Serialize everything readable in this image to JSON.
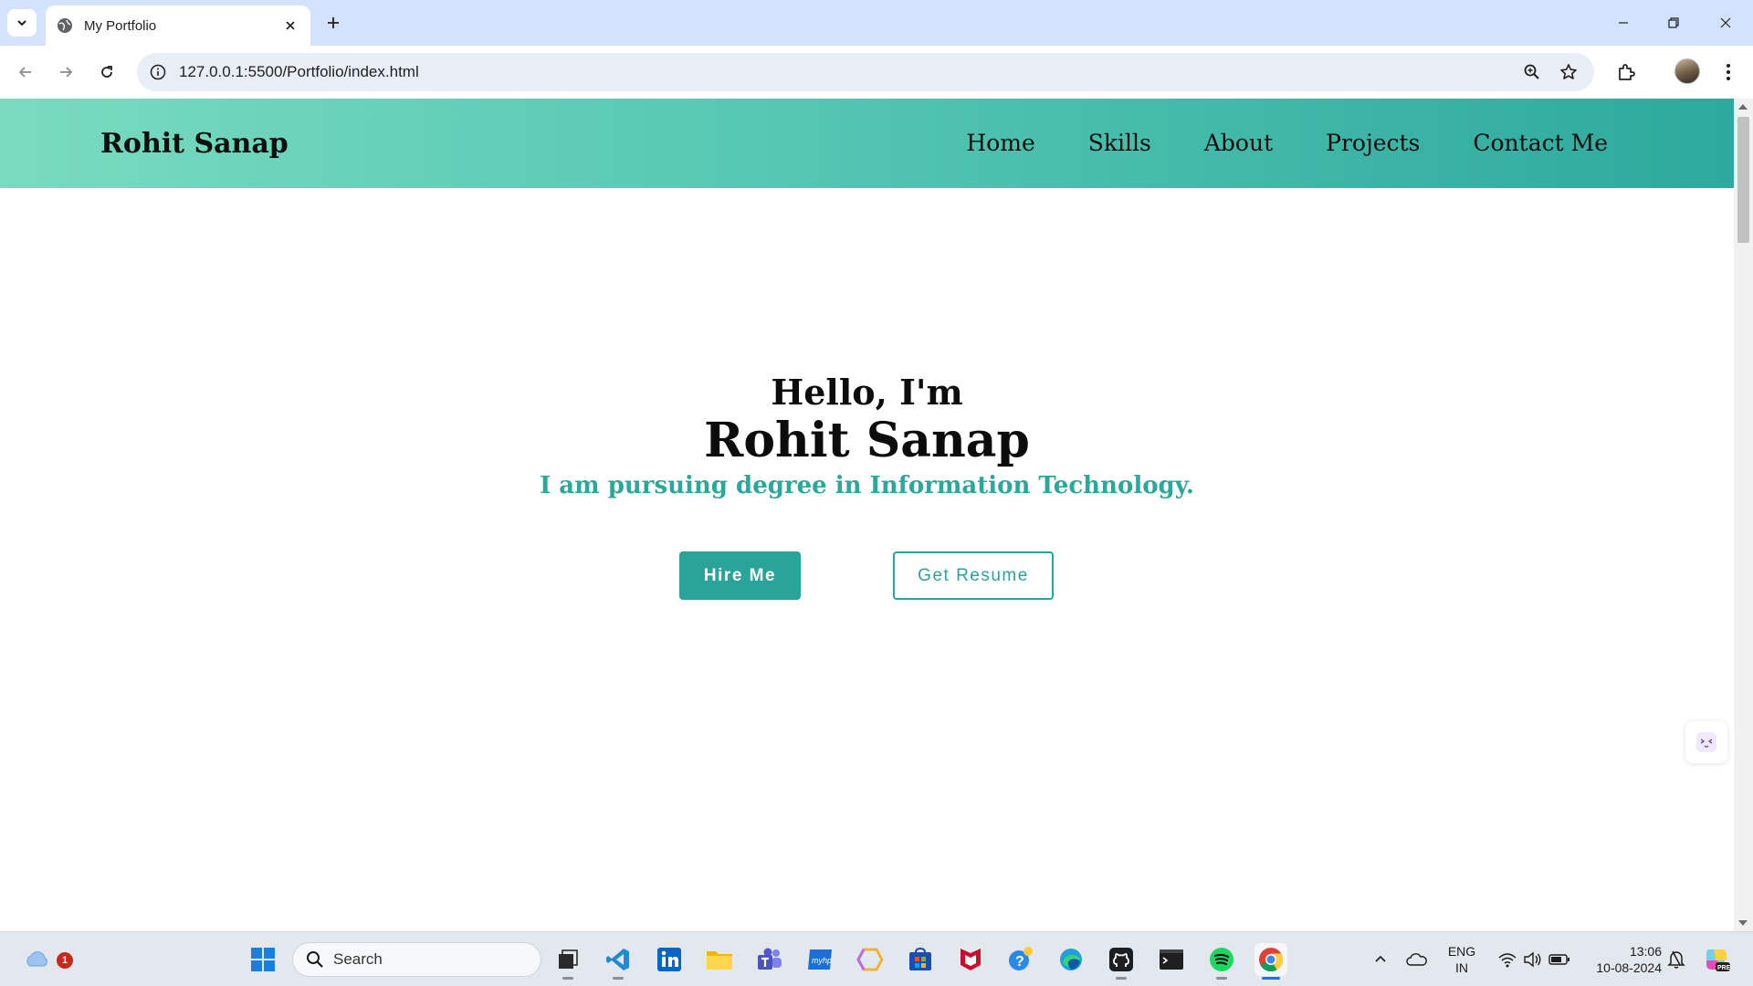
{
  "browser": {
    "tab_title": "My Portfolio",
    "url": "127.0.0.1:5500/Portfolio/index.html"
  },
  "page": {
    "brand": "Rohit Sanap",
    "nav": [
      "Home",
      "Skills",
      "About",
      "Projects",
      "Contact Me"
    ],
    "hero": {
      "greeting": "Hello, I'm",
      "name": "Rohit Sanap",
      "tagline": "I am pursuing degree in Information Technology.",
      "primary_button": "Hire Me",
      "secondary_button": "Get Resume"
    },
    "colors": {
      "accent": "#2aa398",
      "navbar_start": "#79dbbf",
      "navbar_end": "#2da99d"
    }
  },
  "taskbar": {
    "search_placeholder": "Search",
    "weather_badge": "1",
    "language_line1": "ENG",
    "language_line2": "IN",
    "time": "13:06",
    "date": "10-08-2024",
    "apps": [
      "start-icon",
      "task-view-icon",
      "vscode-icon",
      "linkedin-icon",
      "file-explorer-icon",
      "teams-icon",
      "myhp-icon",
      "copilot-icon",
      "store-icon",
      "mcafee-icon",
      "help-icon",
      "edge-icon",
      "github-icon",
      "terminal-icon",
      "spotify-icon",
      "chrome-icon"
    ]
  }
}
